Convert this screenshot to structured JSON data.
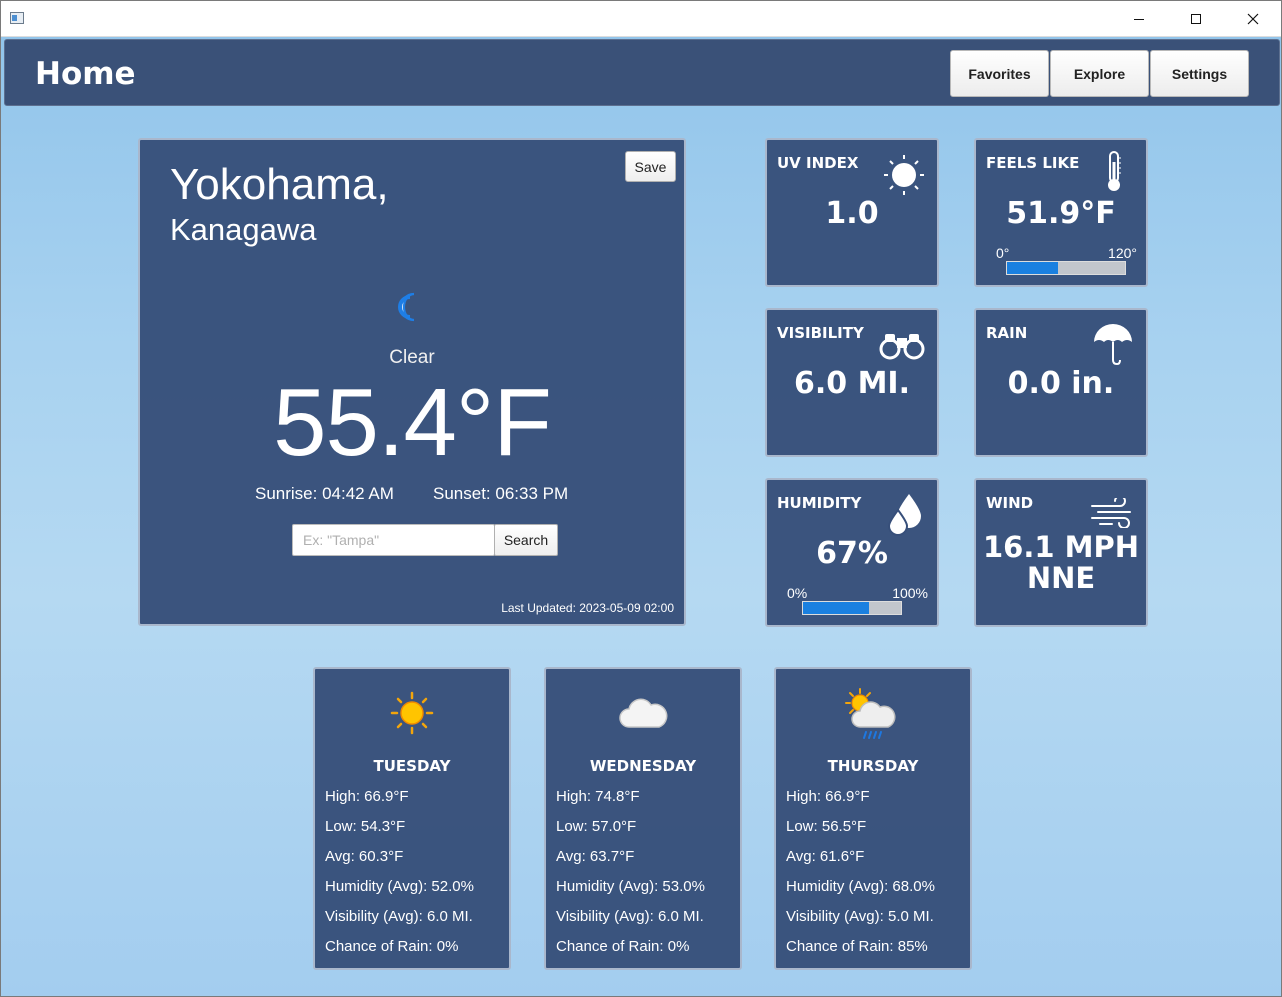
{
  "window": {
    "controls": {
      "minimize": "minimize",
      "maximize": "maximize",
      "close": "close"
    }
  },
  "header": {
    "title": "Home",
    "nav": [
      "Favorites",
      "Explore",
      "Settings"
    ]
  },
  "current": {
    "city": "Yokohama,",
    "region": "Kanagawa",
    "save_label": "Save",
    "condition": "Clear",
    "condition_icon": "moon-icon",
    "temperature": "55.4°F",
    "sunrise": "Sunrise: 04:42 AM",
    "sunset": "Sunset: 06:33 PM",
    "search": {
      "value": "",
      "placeholder": "Ex: \"Tampa\"",
      "button": "Search"
    },
    "last_updated": "Last Updated: 2023-05-09 02:00"
  },
  "stats": {
    "uv": {
      "label": "UV INDEX",
      "value": "1.0",
      "icon": "sun-icon"
    },
    "feels_like": {
      "label": "FEELS LIKE",
      "value": "51.9°F",
      "icon": "thermometer-icon",
      "range_min": "0°",
      "range_max": "120°",
      "fill_fraction": 0.43
    },
    "visibility": {
      "label": "VISIBILITY",
      "value": "6.0 MI.",
      "icon": "binoculars-icon"
    },
    "rain": {
      "label": "RAIN",
      "value": "0.0 in.",
      "icon": "umbrella-icon"
    },
    "humidity": {
      "label": "HUMIDITY",
      "value": "67%",
      "icon": "water-drops-icon",
      "range_min": "0%",
      "range_max": "100%",
      "fill_fraction": 0.67
    },
    "wind": {
      "label": "WIND",
      "value_line1": "16.1 MPH",
      "value_line2": "NNE",
      "icon": "wind-icon"
    }
  },
  "forecast": [
    {
      "day": "TUESDAY",
      "icon": "sunny-icon",
      "high": "High: 66.9°F",
      "low": "Low: 54.3°F",
      "avg": "Avg: 60.3°F",
      "humidity": "Humidity (Avg): 52.0%",
      "visibility": "Visibility (Avg): 6.0 MI.",
      "rain": "Chance of Rain: 0%"
    },
    {
      "day": "WEDNESDAY",
      "icon": "cloud-icon",
      "high": "High: 74.8°F",
      "low": "Low: 57.0°F",
      "avg": "Avg: 63.7°F",
      "humidity": "Humidity (Avg): 53.0%",
      "visibility": "Visibility (Avg): 6.0 MI.",
      "rain": "Chance of Rain: 0%"
    },
    {
      "day": "THURSDAY",
      "icon": "partly-cloudy-rain-icon",
      "high": "High: 66.9°F",
      "low": "Low: 56.5°F",
      "avg": "Avg: 61.6°F",
      "humidity": "Humidity (Avg): 68.0%",
      "visibility": "Visibility (Avg): 5.0 MI.",
      "rain": "Chance of Rain: 85%"
    }
  ],
  "colors": {
    "card": "#374f7a",
    "header": "#3a5178",
    "bar_fill": "#1a80e0",
    "bar_track": "#c2c6cc"
  }
}
